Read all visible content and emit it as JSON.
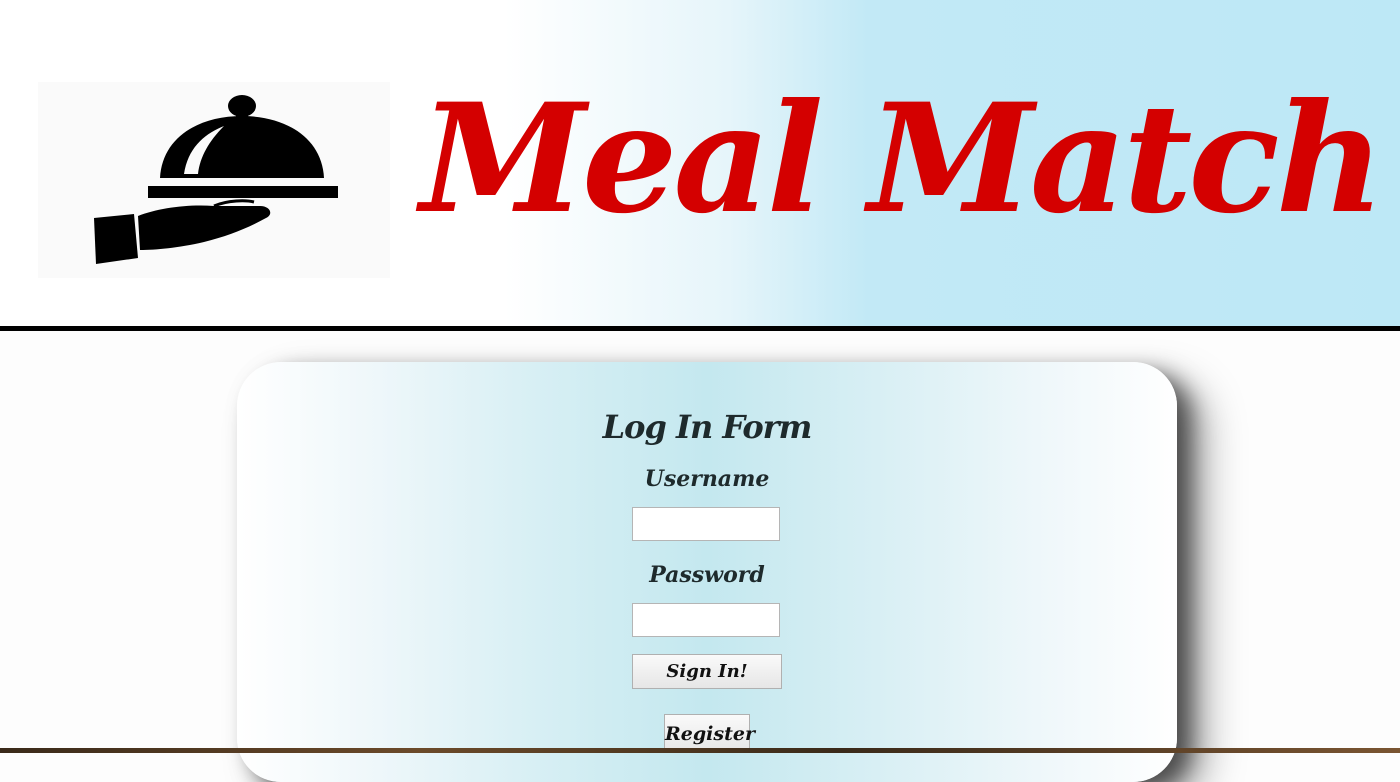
{
  "header": {
    "brand_name": "Meal Match",
    "logo_icon": "serving-cloche-hand-icon",
    "brand_color": "#d40000"
  },
  "login_form": {
    "title": "Log In Form",
    "username_label": "Username",
    "username_value": "",
    "password_label": "Password",
    "password_value": "",
    "sign_in_label": "Sign In!",
    "register_label": "Register"
  }
}
